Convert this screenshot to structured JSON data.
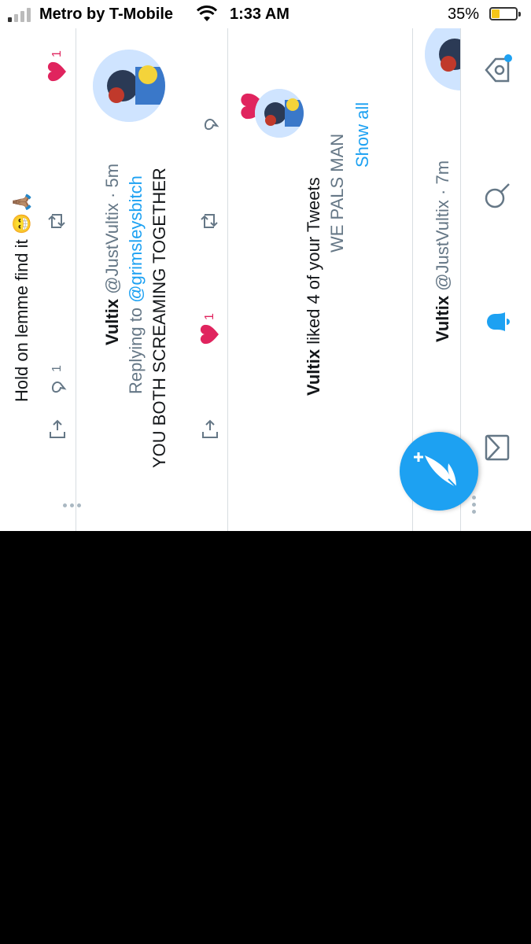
{
  "status_bar": {
    "carrier": "Metro by T-Mobile",
    "time": "1:33 AM",
    "battery": "35%",
    "battery_color": "#f5c518",
    "signal_icon": "signal-bars-icon",
    "wifi_icon": "wifi-icon"
  },
  "tweets": [
    {
      "text": "Hold on lemme find it 😁🙏🏽",
      "reply_count": "1",
      "like_count": "1"
    },
    {
      "name": "Vultix",
      "handle": "@JustVultix",
      "time": "· 5m",
      "replying_prefix": "Replying to",
      "replying_to": "@grimsleysbitch",
      "text": "YOU BOTH SCREAMING TOGETHER",
      "like_count": "1"
    }
  ],
  "notification": {
    "actor": "Vultix",
    "action": "liked 4 of your Tweets",
    "preview": "WE PALS MAN",
    "show_all": "Show all"
  },
  "partial_tweet": {
    "name": "Vultix",
    "handle": "@JustVultix",
    "time": "· 7m"
  },
  "tab_bar": {
    "items": [
      "home-icon",
      "search-icon",
      "notifications-icon",
      "messages-icon"
    ],
    "active": "notifications-icon"
  },
  "colors": {
    "accent": "#1da1f2",
    "like": "#e0245e",
    "muted": "#657786"
  }
}
